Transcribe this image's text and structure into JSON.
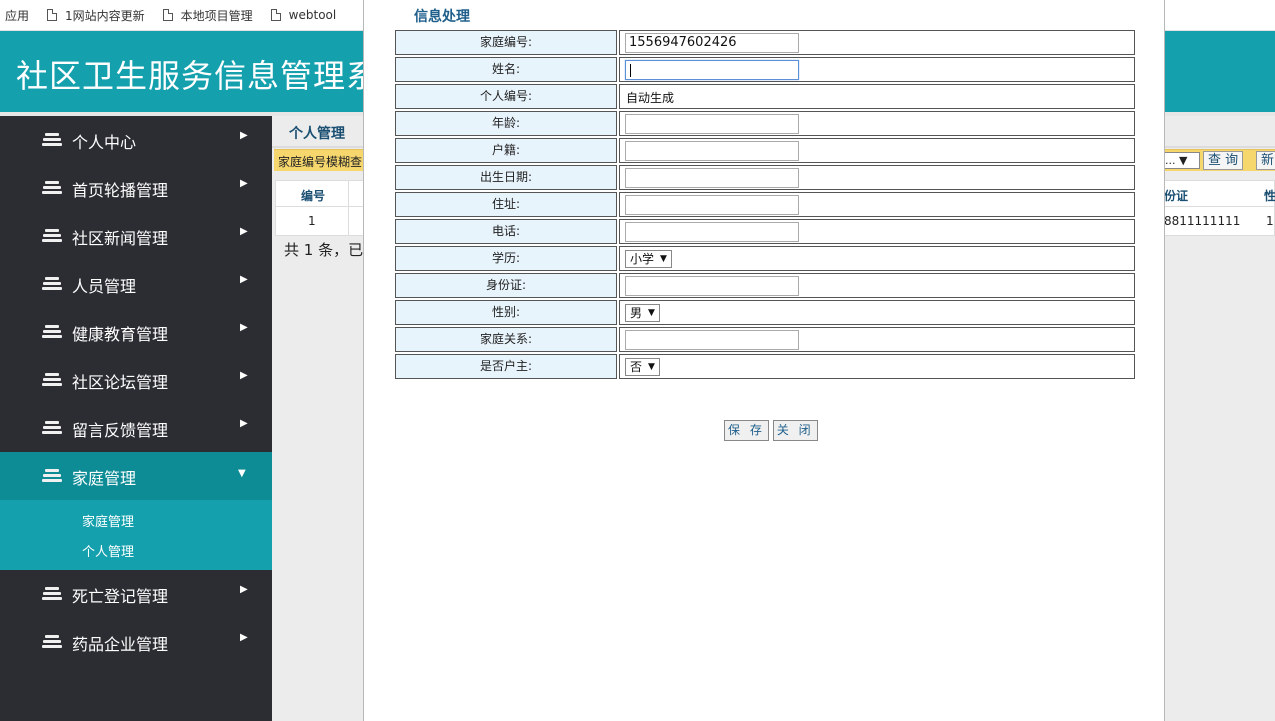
{
  "bookmarks": {
    "apps": "应用",
    "items": [
      "1网站内容更新",
      "本地项目管理",
      "webtool"
    ]
  },
  "header": {
    "title": "社区卫生服务信息管理系统"
  },
  "sidebar": {
    "items": [
      {
        "label": "个人中心"
      },
      {
        "label": "首页轮播管理"
      },
      {
        "label": "社区新闻管理"
      },
      {
        "label": "人员管理"
      },
      {
        "label": "健康教育管理"
      },
      {
        "label": "社区论坛管理"
      },
      {
        "label": "留言反馈管理"
      },
      {
        "label": "家庭管理"
      },
      {
        "label": "死亡登记管理"
      },
      {
        "label": "药品企业管理"
      }
    ],
    "submenu": [
      "家庭管理",
      "个人管理"
    ]
  },
  "main": {
    "title": "个人管理",
    "search_label": "家庭编号模糊查",
    "select_value": "...",
    "query_button": "查 询",
    "new_button": "新",
    "table": {
      "col_id": "编号",
      "col_idcard": "份证",
      "col_gender": "性",
      "row_id": "1",
      "row_idcard": "8811111111",
      "row_gender": "1"
    },
    "count_text": "共 1 条，已"
  },
  "dialog": {
    "title": "信息处理",
    "labels": {
      "family_no": "家庭编号:",
      "name": "姓名:",
      "person_no": "个人编号:",
      "age": "年龄:",
      "hukou": "户籍:",
      "birth": "出生日期:",
      "address": "住址:",
      "phone": "电话:",
      "education": "学历:",
      "idcard": "身份证:",
      "gender": "性别:",
      "relation": "家庭关系:",
      "householder": "是否户主:"
    },
    "values": {
      "family_no": "1556947602426",
      "name": "",
      "person_no": "自动生成",
      "age": "",
      "hukou": "",
      "birth": "",
      "address": "",
      "phone": "",
      "education": "小学",
      "idcard": "",
      "gender": "男",
      "relation": "",
      "householder": "否"
    },
    "save_button": "保 存",
    "close_button": "关 闭"
  }
}
